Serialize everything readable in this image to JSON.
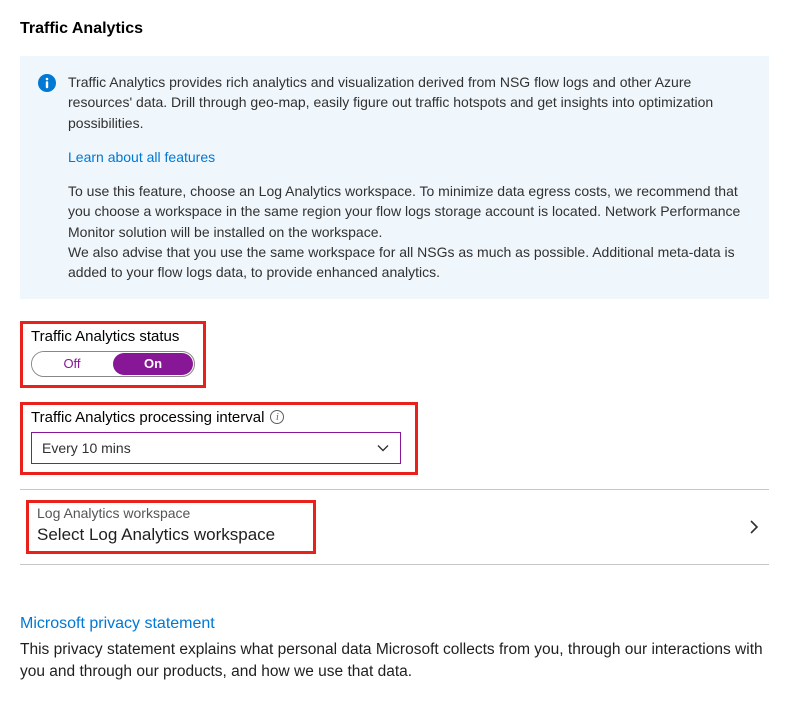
{
  "header": {
    "title": "Traffic Analytics"
  },
  "infoBox": {
    "paragraph1": "Traffic Analytics provides rich analytics and visualization derived from NSG flow logs and other Azure resources' data. Drill through geo-map, easily figure out traffic hotspots and get insights into optimization possibilities.",
    "learnLink": "Learn about all features",
    "paragraph2": "To use this feature, choose an Log Analytics workspace. To minimize data egress costs, we recommend that you choose a workspace in the same region your flow logs storage account is located. Network Performance Monitor solution will be installed on the workspace.",
    "paragraph3": "We also advise that you use the same workspace for all NSGs as much as possible. Additional meta-data is added to your flow logs data, to provide enhanced analytics."
  },
  "status": {
    "label": "Traffic Analytics status",
    "off": "Off",
    "on": "On",
    "value": "On"
  },
  "interval": {
    "label": "Traffic Analytics processing interval",
    "value": "Every 10 mins"
  },
  "workspace": {
    "label": "Log Analytics workspace",
    "value": "Select Log Analytics workspace"
  },
  "privacy": {
    "title": "Microsoft privacy statement",
    "text": "This privacy statement explains what personal data Microsoft collects from you, through our interactions with you and through our products, and how we use that data."
  }
}
